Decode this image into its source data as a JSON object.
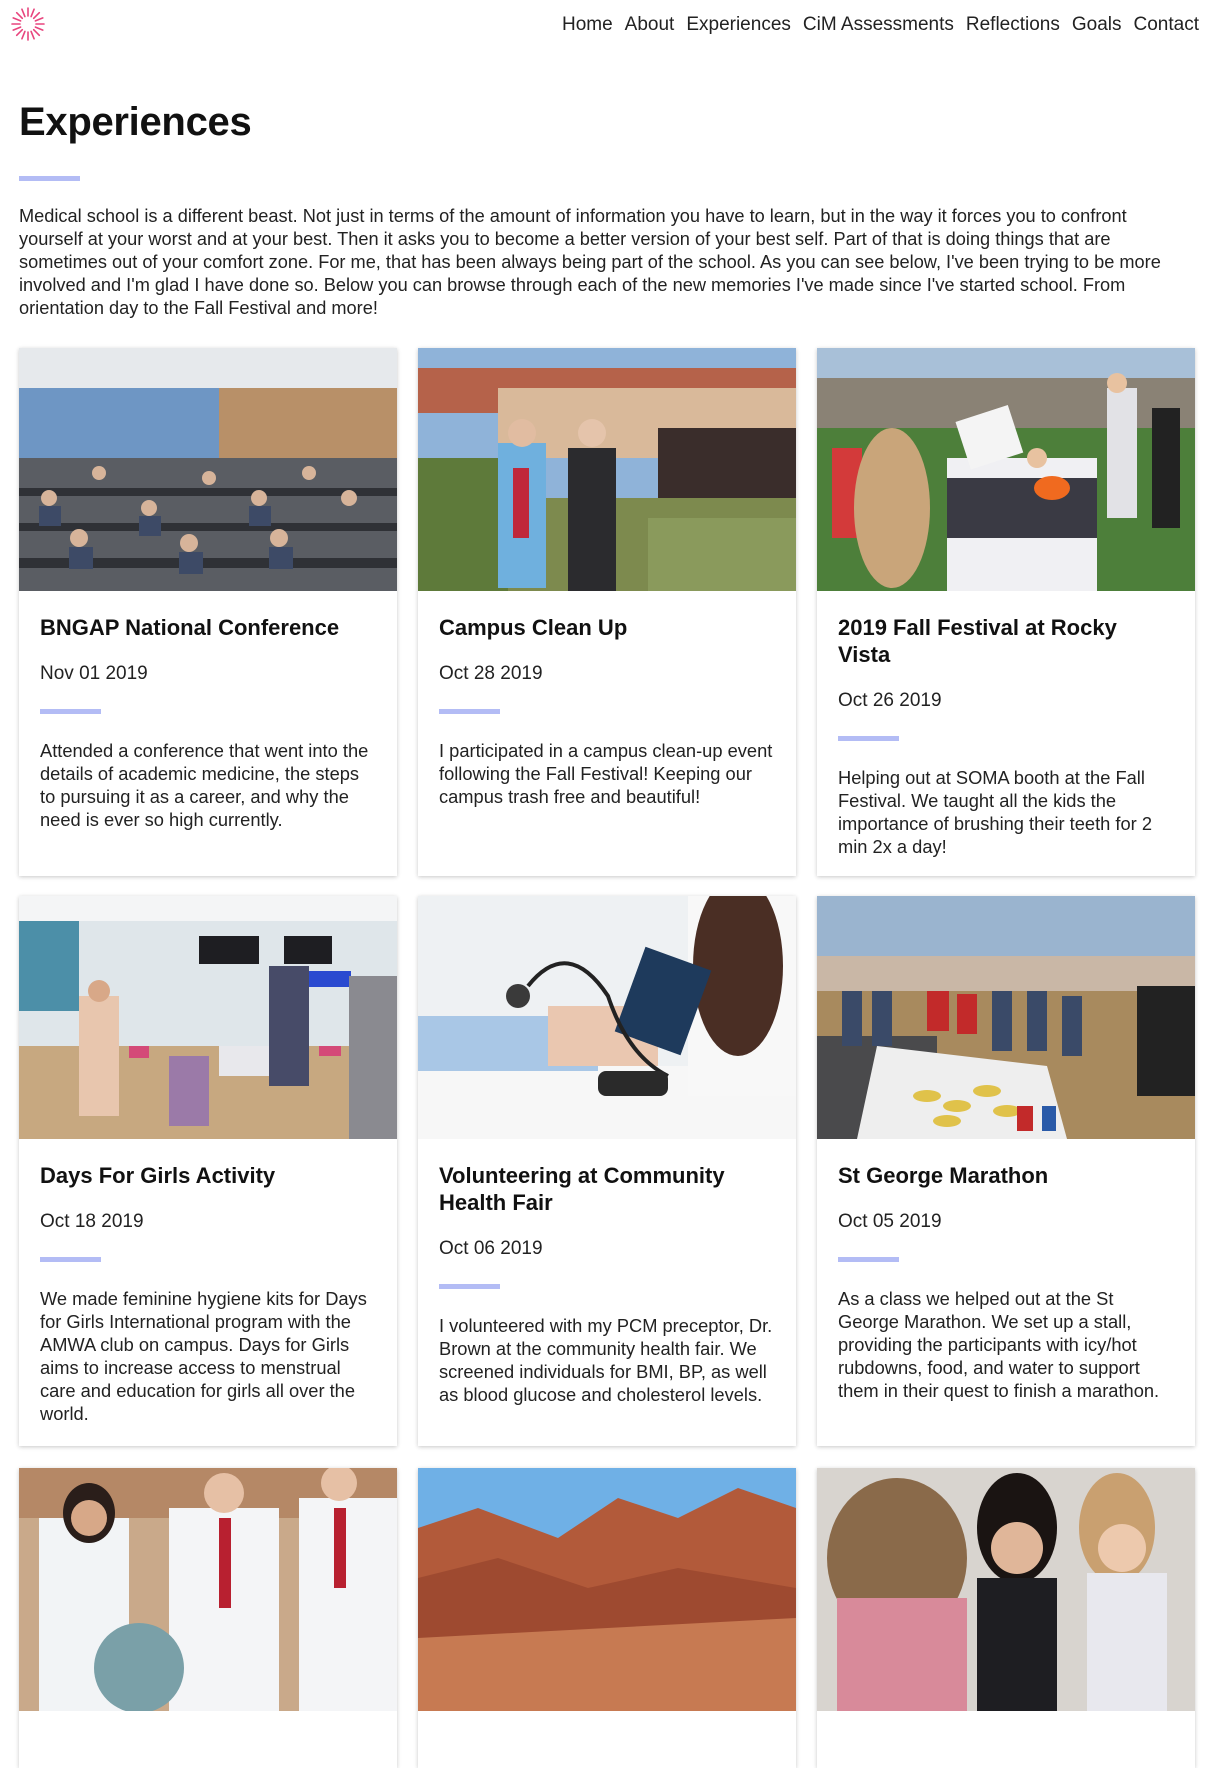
{
  "nav": {
    "logo_icon": "sun-burst-logo-icon",
    "items": [
      "Home",
      "About",
      "Experiences",
      "CiM Assessments",
      "Reflections",
      "Goals",
      "Contact"
    ]
  },
  "page": {
    "title": "Experiences",
    "intro": "Medical school is a different beast. Not just in terms of the amount of information you have to learn, but in the way it forces you to confront yourself at your worst and at your best. Then it asks you to become a better version of your best self. Part of that is doing things that are sometimes out of your comfort zone. For me, that has been always being part of the school. As you can see below, I've been trying to be more involved and I'm glad I have done so. Below you can browse through each of the new memories I've made since I've started school. From orientation day to the Fall Festival and more!"
  },
  "colors": {
    "accent_rule": "#b3bcf5",
    "logo": "#e8457e"
  },
  "cards": [
    {
      "title": "BNGAP National Conference",
      "date": "Nov 01 2019",
      "desc": "Attended a conference that went into the details of academic medicine, the steps to pursuing it as a career, and why the need is ever so high currently."
    },
    {
      "title": "Campus Clean Up",
      "date": "Oct 28 2019",
      "desc": "I participated in a campus clean-up event following the Fall Festival! Keeping our campus trash free and beautiful!"
    },
    {
      "title": "2019 Fall Festival at Rocky Vista",
      "date": "Oct 26 2019",
      "desc": "Helping out at SOMA booth at the Fall Festival. We taught all the kids the importance of brushing their teeth for 2 min 2x a day!"
    },
    {
      "title": "Days For Girls Activity",
      "date": "Oct 18 2019",
      "desc": "We made feminine hygiene kits for Days for Girls International program with the AMWA club on campus. Days for Girls aims to increase access to menstrual care and education for girls all over the world."
    },
    {
      "title": "Volunteering at Community Health Fair",
      "date": "Oct 06 2019",
      "desc": "I volunteered with my PCM preceptor, Dr. Brown at the community health fair. We screened individuals for BMI, BP, as well as blood glucose and cholesterol levels."
    },
    {
      "title": "St George Marathon",
      "date": "Oct 05 2019",
      "desc": "As a class we helped out at the St George Marathon. We set up a stall, providing the participants with icy/hot rubdowns, food, and water to support them in their quest to finish a marathon."
    },
    {
      "title": "",
      "date": "",
      "desc": ""
    },
    {
      "title": "",
      "date": "",
      "desc": ""
    },
    {
      "title": "",
      "date": "",
      "desc": ""
    }
  ]
}
